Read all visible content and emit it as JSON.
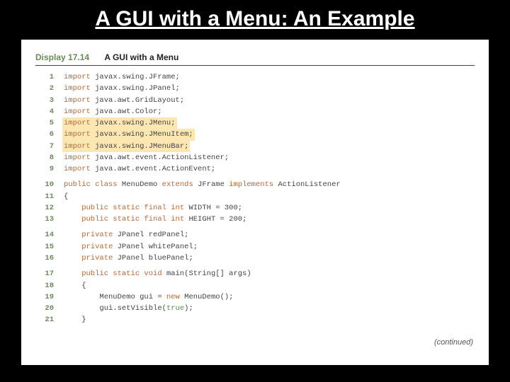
{
  "slide": {
    "title": "A GUI with a Menu: An Example"
  },
  "display": {
    "label": "Display 17.14",
    "title": "A GUI with a Menu",
    "continued": "(continued)"
  },
  "code": {
    "lines": [
      {
        "n": "1",
        "hl": false,
        "tokens": [
          "import ",
          "javax.swing.JFrame;"
        ]
      },
      {
        "n": "2",
        "hl": false,
        "tokens": [
          "import ",
          "javax.swing.JPanel;"
        ]
      },
      {
        "n": "3",
        "hl": false,
        "tokens": [
          "import ",
          "java.awt.GridLayout;"
        ]
      },
      {
        "n": "4",
        "hl": false,
        "tokens": [
          "import ",
          "java.awt.Color;"
        ]
      },
      {
        "n": "5",
        "hl": true,
        "tokens": [
          "import ",
          "javax.swing.JMenu;"
        ]
      },
      {
        "n": "6",
        "hl": true,
        "tokens": [
          "import ",
          "javax.swing.JMenuItem;"
        ]
      },
      {
        "n": "7",
        "hl": true,
        "tokens": [
          "import ",
          "javax.swing.JMenuBar;"
        ]
      },
      {
        "n": "8",
        "hl": false,
        "tokens": [
          "import ",
          "java.awt.event.ActionListener;"
        ]
      },
      {
        "n": "9",
        "hl": false,
        "tokens": [
          "import ",
          "java.awt.event.ActionEvent;"
        ]
      }
    ],
    "line10": {
      "n": "10",
      "t1": "public class ",
      "t2": "MenuDemo ",
      "t3": "extends ",
      "t4": "JFrame ",
      "t5": "implements ",
      "t6": "ActionListener"
    },
    "line11": {
      "n": "11",
      "text": "{"
    },
    "line12": {
      "n": "12",
      "kw": "    public static final int ",
      "rest": "WIDTH = 300;"
    },
    "line13": {
      "n": "13",
      "kw": "    public static final int ",
      "rest": "HEIGHT = 200;"
    },
    "line14": {
      "n": "14",
      "kw": "    private ",
      "type": "JPanel ",
      "name": "redPanel;"
    },
    "line15": {
      "n": "15",
      "kw": "    private ",
      "type": "JPanel ",
      "name": "whitePanel;"
    },
    "line16": {
      "n": "16",
      "kw": "    private ",
      "type": "JPanel ",
      "name": "bluePanel;"
    },
    "line17": {
      "n": "17",
      "kw": "    public static void ",
      "rest": "main(String[] args)"
    },
    "line18": {
      "n": "18",
      "text": "    {"
    },
    "line19": {
      "n": "19",
      "pre": "        MenuDemo gui = ",
      "nw": "new ",
      "post": "MenuDemo();"
    },
    "line20": {
      "n": "20",
      "pre": "        gui.setVisible(",
      "lit": "true",
      "post": ");"
    },
    "line21": {
      "n": "21",
      "text": "    }"
    }
  }
}
